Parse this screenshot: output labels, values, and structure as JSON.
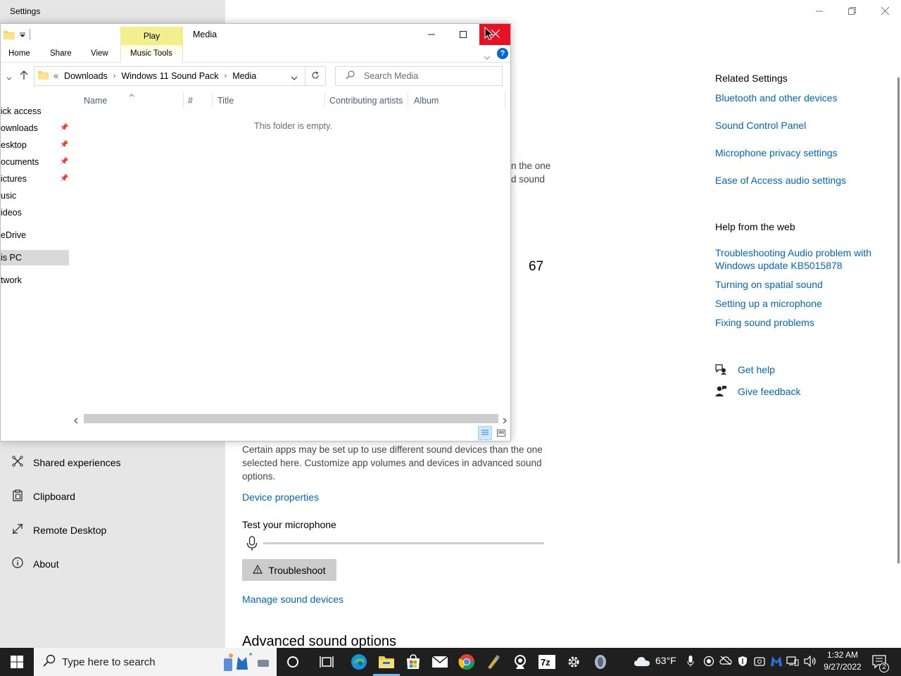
{
  "settings": {
    "title": "Settings",
    "sidebar": [
      {
        "label": "Shared experiences",
        "icon": "shared-experiences-icon"
      },
      {
        "label": "Clipboard",
        "icon": "clipboard-icon"
      },
      {
        "label": "Remote Desktop",
        "icon": "remote-desktop-icon"
      },
      {
        "label": "About",
        "icon": "info-icon"
      }
    ],
    "partial_text_line1": "n the one",
    "partial_text_line2": "d sound",
    "volume_value": "67",
    "app_devices_text": "Certain apps may be set up to use different sound devices than the one selected here. Customize app volumes and devices in advanced sound options.",
    "device_properties_link": "Device properties",
    "test_mic_label": "Test your microphone",
    "mic_level": 0,
    "troubleshoot_label": "Troubleshoot",
    "manage_devices_link": "Manage sound devices",
    "advanced_title": "Advanced sound options",
    "related": {
      "title": "Related Settings",
      "links": [
        "Bluetooth and other devices",
        "Sound Control Panel",
        "Microphone privacy settings",
        "Ease of Access audio settings"
      ]
    },
    "help": {
      "title": "Help from the web",
      "links": [
        "Troubleshooting Audio problem with Windows update KB5015878",
        "Turning on spatial sound",
        "Setting up a microphone",
        "Fixing sound problems"
      ]
    },
    "get_help": "Get help",
    "give_feedback": "Give feedback"
  },
  "explorer": {
    "contextual_tab": "Play",
    "title": "Media",
    "ribbon_tabs": [
      "Home",
      "Share",
      "View",
      "Music Tools"
    ],
    "breadcrumb": [
      "Downloads",
      "Windows 11 Sound Pack",
      "Media"
    ],
    "search_placeholder": "Search Media",
    "nav_items": [
      {
        "label": "ick access",
        "pinned": false
      },
      {
        "label": "ownloads",
        "pinned": true
      },
      {
        "label": "esktop",
        "pinned": true
      },
      {
        "label": "ocuments",
        "pinned": true
      },
      {
        "label": "ictures",
        "pinned": true
      },
      {
        "label": "usic",
        "pinned": false
      },
      {
        "label": "ideos",
        "pinned": false
      },
      {
        "label": "eDrive",
        "pinned": false
      },
      {
        "label": "is PC",
        "pinned": false
      },
      {
        "label": "twork",
        "pinned": false
      }
    ],
    "columns": [
      "Name",
      "#",
      "Title",
      "Contributing artists",
      "Album"
    ],
    "empty_message": "This folder is empty."
  },
  "taskbar": {
    "search_placeholder": "Type here to search",
    "weather": "63°F",
    "time": "1:32 AM",
    "date": "9/27/2022",
    "notification_count": "2"
  }
}
